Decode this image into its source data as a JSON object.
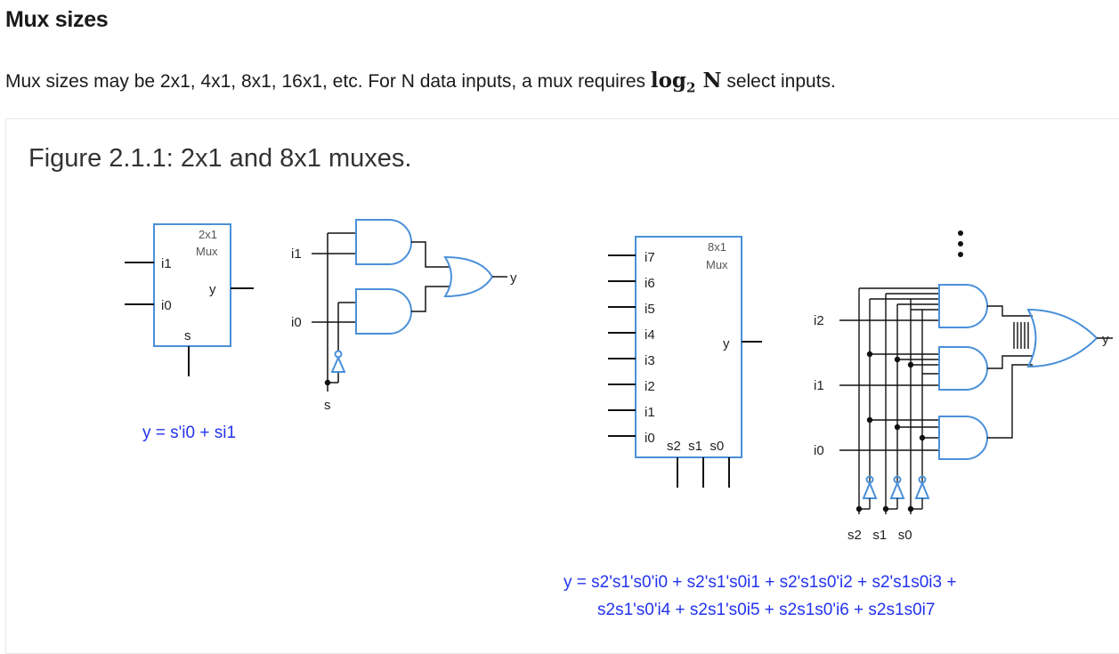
{
  "section": {
    "title": "Mux sizes",
    "intro_text": "Mux sizes may be 2x1, 4x1, 8x1, 16x1, etc. For N data inputs, a mux requires ",
    "math_log": "log",
    "math_base": "2",
    "math_n": "N",
    "intro_tail": " select inputs."
  },
  "figure": {
    "caption": "Figure 2.1.1: 2x1 and 8x1 muxes.",
    "mux2x1": {
      "title_line1": "2x1",
      "title_line2": "Mux",
      "input_i1": "i1",
      "input_i0": "i0",
      "output_y": "y",
      "select_s": "s",
      "equation": "y = s'i0 + si1"
    },
    "gates2x1": {
      "input_i1": "i1",
      "input_i0": "i0",
      "output_y": "y",
      "select_s": "s"
    },
    "mux8x1": {
      "title_line1": "8x1",
      "title_line2": "Mux",
      "inputs": [
        "i7",
        "i6",
        "i5",
        "i4",
        "i3",
        "i2",
        "i1",
        "i0"
      ],
      "output_y": "y",
      "selects": "s2  s1  s0"
    },
    "gates8x1": {
      "input_i2": "i2",
      "input_i1": "i1",
      "input_i0": "i0",
      "output_y": "y",
      "selects": "s2   s1   s0",
      "ellipsis": "⋮"
    },
    "equation8x1_line1": "y = s2's1's0'i0 + s2's1's0i1 + s2's1s0'i2 + s2's1s0i3 +",
    "equation8x1_line2": "s2s1's0'i4 + s2s1's0i5 + s2s1s0'i6 + s2s1s0i7"
  },
  "colors": {
    "gate_outline": "#4a90d9",
    "equation_text": "#2233ee",
    "wire": "#111111"
  }
}
